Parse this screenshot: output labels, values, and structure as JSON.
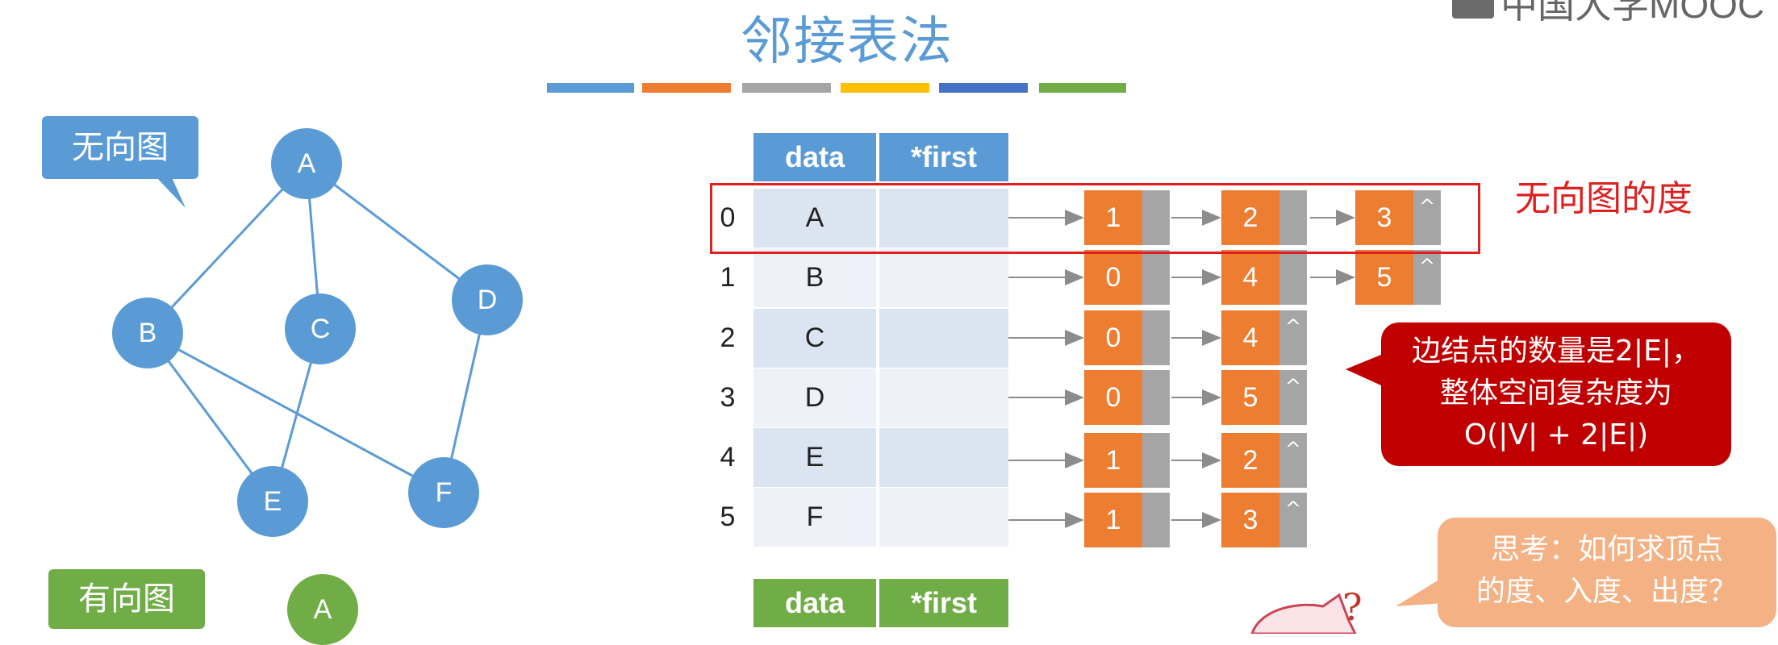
{
  "title": "邻接表法",
  "logo": {
    "text": "中国大学MOOC"
  },
  "color_bar": [
    "#5b9bd5",
    "#ed7d31",
    "#a5a5a5",
    "#ffc000",
    "#4472c4",
    "#70ad47"
  ],
  "undirected": {
    "label": "无向图",
    "nodes": [
      "A",
      "B",
      "C",
      "D",
      "E",
      "F"
    ]
  },
  "directed": {
    "label": "有向图",
    "nodes": [
      "A"
    ]
  },
  "vertex_table": {
    "headers": [
      "data",
      "*first"
    ],
    "rows": [
      {
        "index": "0",
        "data": "A"
      },
      {
        "index": "1",
        "data": "B"
      },
      {
        "index": "2",
        "data": "C"
      },
      {
        "index": "3",
        "data": "D"
      },
      {
        "index": "4",
        "data": "E"
      },
      {
        "index": "5",
        "data": "F"
      }
    ]
  },
  "edge_lists": [
    {
      "values": [
        "1",
        "2",
        "3"
      ],
      "null_marker": "^"
    },
    {
      "values": [
        "0",
        "4",
        "5"
      ],
      "null_marker": "^"
    },
    {
      "values": [
        "0",
        "4"
      ],
      "null_marker": "^"
    },
    {
      "values": [
        "0",
        "5"
      ],
      "null_marker": "^"
    },
    {
      "values": [
        "1",
        "2"
      ],
      "null_marker": "^"
    },
    {
      "values": [
        "1",
        "3"
      ],
      "null_marker": "^"
    }
  ],
  "directed_table": {
    "headers": [
      "data",
      "*first"
    ]
  },
  "degree_label": "无向图的度",
  "callout_red": {
    "line1": "边结点的数量是2|E|，",
    "line2": "整体空间复杂度为",
    "line3": "O(|V| + 2|E|)"
  },
  "callout_orange": {
    "line1": "思考：如何求顶点",
    "line2": "的度、入度、出度？"
  },
  "mascot_mark": "?"
}
